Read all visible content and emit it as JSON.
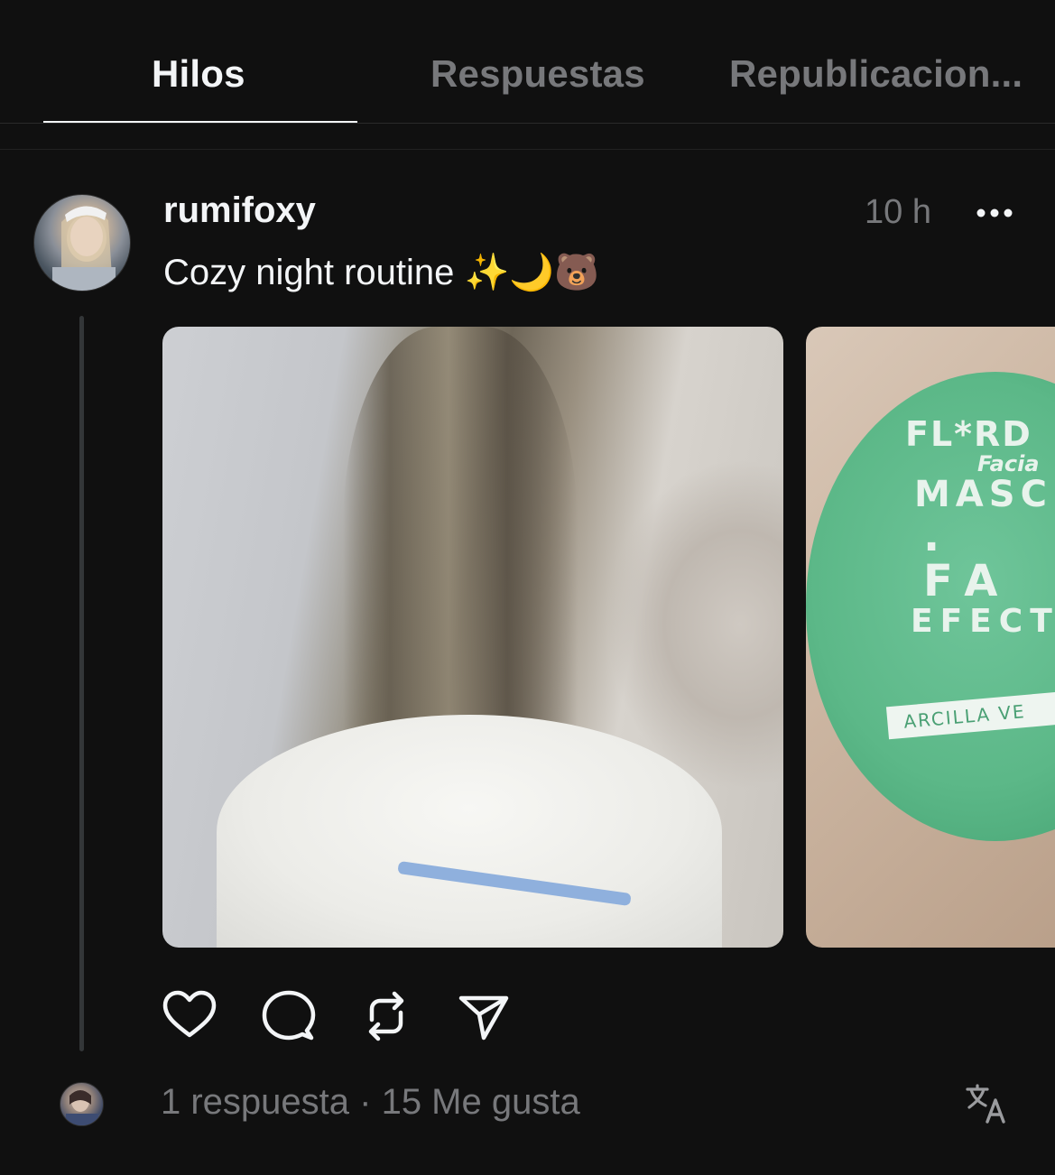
{
  "tabs": [
    {
      "label": "Hilos",
      "active": true
    },
    {
      "label": "Respuestas",
      "active": false
    },
    {
      "label": "Republicacion...",
      "active": false
    }
  ],
  "post": {
    "username": "rumifoxy",
    "timestamp": "10 h",
    "text": "Cozy night routine ✨🌙🐻",
    "media": [
      {
        "alt": "face-mask-photo"
      },
      {
        "alt": "clay-mask-jar-photo",
        "printed_text": [
          "FL*RD",
          "Facia",
          "MASC",
          ". FA",
          "EFECT",
          "ARCILLA VE"
        ]
      }
    ],
    "actions": [
      "heart-icon",
      "comment-icon",
      "repost-icon",
      "share-icon"
    ],
    "replies_summary": "1 respuesta · 15 Me gusta"
  },
  "colors": {
    "background": "#101010",
    "text_primary": "#f3f5f7",
    "text_secondary": "#77787b",
    "divider": "#2a2a2a"
  }
}
